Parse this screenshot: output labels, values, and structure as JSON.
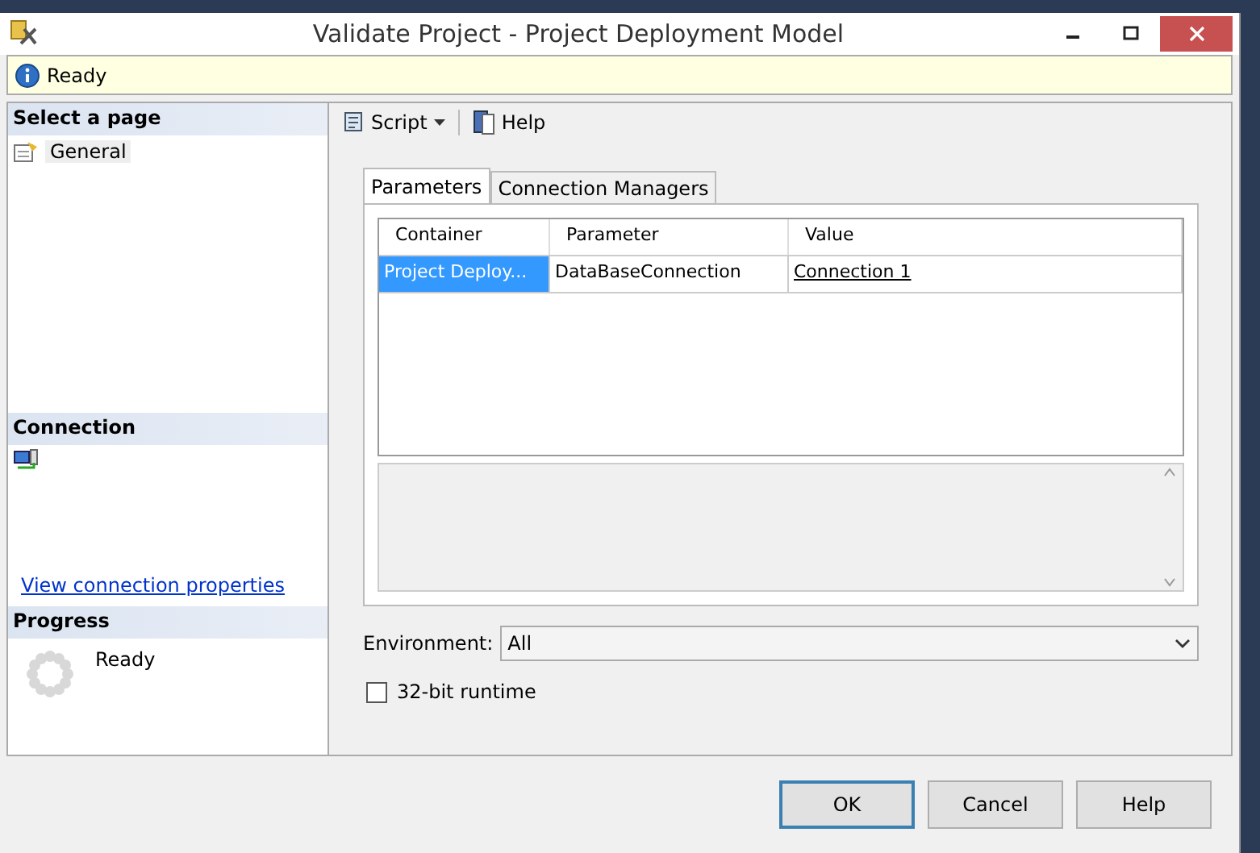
{
  "window": {
    "title": "Validate Project - Project Deployment Model"
  },
  "info_bar": {
    "text": "Ready"
  },
  "sidebar": {
    "select_heading": "Select a page",
    "pages": [
      {
        "label": "General",
        "selected": true
      }
    ],
    "connection_heading": "Connection",
    "connection_link": "View connection properties",
    "progress_heading": "Progress",
    "progress_status": "Ready"
  },
  "toolbar": [
    {
      "label": "Script",
      "kind": "dropdown"
    },
    {
      "label": "Help",
      "kind": "button"
    }
  ],
  "tabs": [
    {
      "label": "Parameters",
      "selected": true
    },
    {
      "label": "Connection Managers",
      "selected": false
    }
  ],
  "table": {
    "columns": [
      "Container",
      "Parameter",
      "Value"
    ],
    "rows": [
      {
        "cells": [
          "Project Deploy...",
          "DataBaseConnection",
          "Connection 1"
        ],
        "selected": true
      }
    ]
  },
  "environment": {
    "label": "Environment:",
    "value": "All"
  },
  "runtime_32bit": {
    "label": "32-bit runtime",
    "checked": false
  },
  "buttons": [
    "OK",
    "Cancel",
    "Help"
  ]
}
